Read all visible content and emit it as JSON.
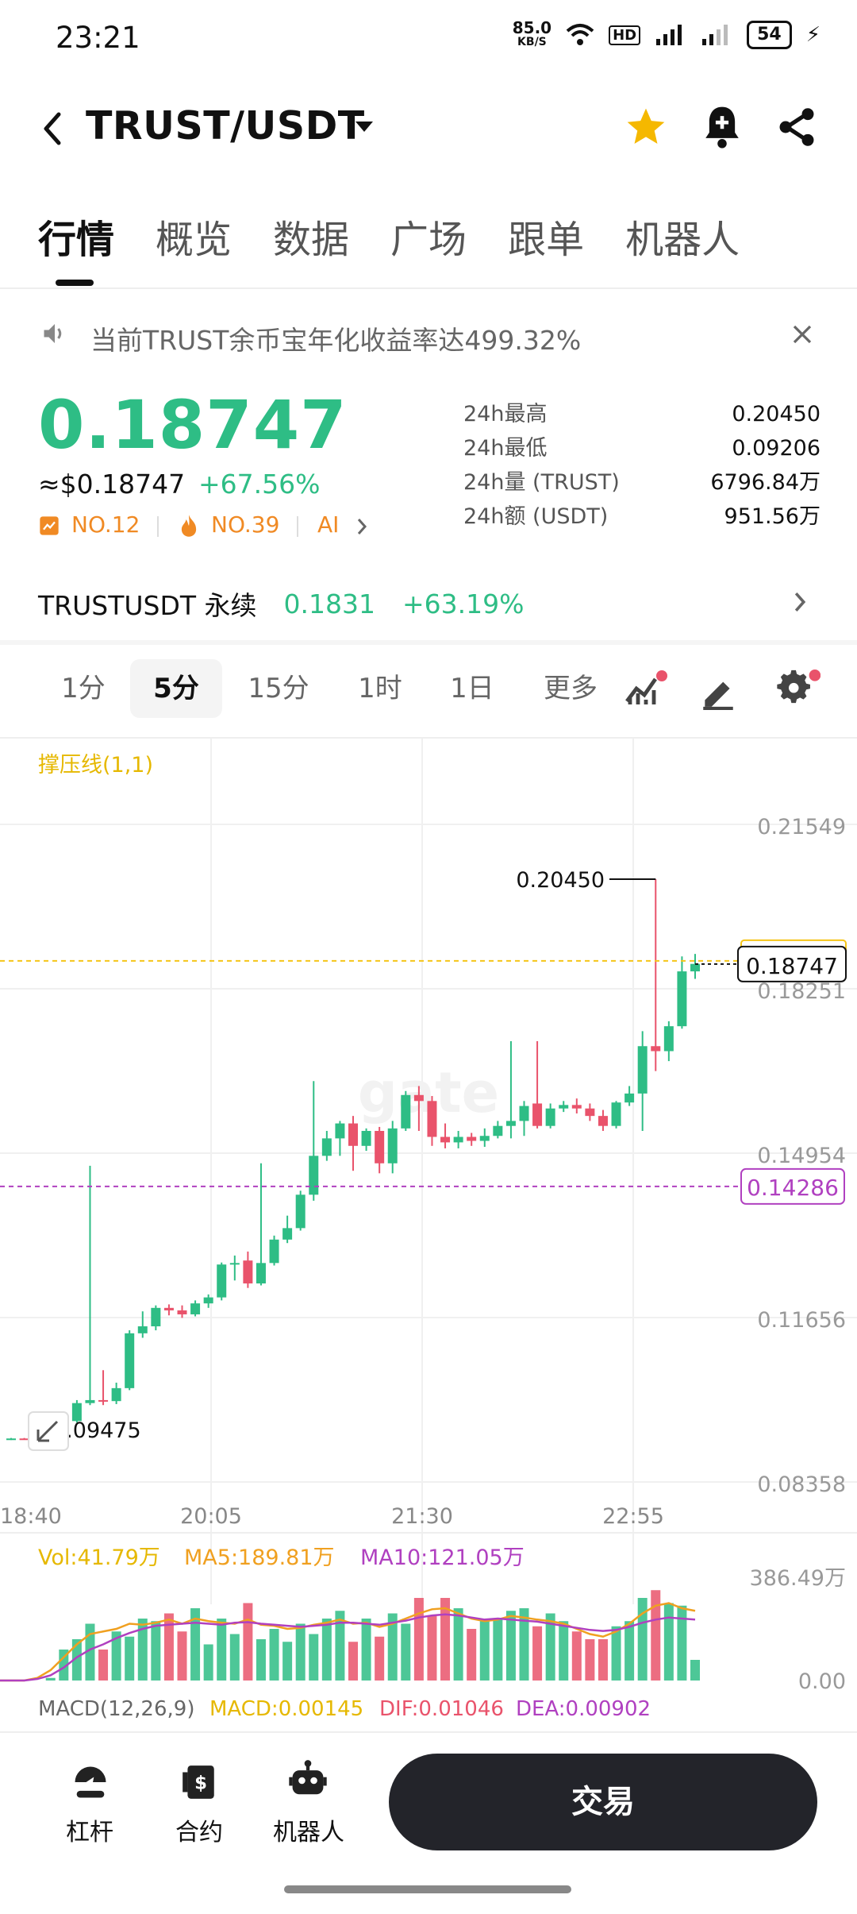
{
  "status_bar": {
    "time": "23:21",
    "net_speed_top": "85.0",
    "net_speed_unit": "KB/S",
    "battery": "54"
  },
  "header": {
    "pair": "TRUST/USDT",
    "icons": [
      "back-icon",
      "dropdown-icon",
      "star-icon",
      "bell-plus-icon",
      "share-icon"
    ]
  },
  "tabs": [
    "行情",
    "概览",
    "数据",
    "广场",
    "跟单",
    "机器人"
  ],
  "notice": {
    "text": "当前TRUST余币宝年化收益率达499.32%"
  },
  "ticker": {
    "price": "0.18747",
    "usd": "≈$0.18747",
    "change": "+67.56%",
    "rank1": "NO.12",
    "rank2": "NO.39",
    "ai": "AI",
    "stats": [
      {
        "label": "24h最高",
        "value": "0.20450"
      },
      {
        "label": "24h最低",
        "value": "0.09206"
      },
      {
        "label": "24h量 (TRUST)",
        "value": "6796.84万"
      },
      {
        "label": "24h额 (USDT)",
        "value": "951.56万"
      }
    ]
  },
  "perp": {
    "name": "TRUSTUSDT 永续",
    "price": "0.1831",
    "change": "+63.19%"
  },
  "timeframes": {
    "items": [
      "1分",
      "5分",
      "15分",
      "1时",
      "1日",
      "更多"
    ],
    "active": "5分"
  },
  "chart": {
    "indicator_label": "撑压线(1,1)",
    "y_ticks": [
      "0.21549",
      "0.18251",
      "0.14954",
      "0.11656",
      "0.08358"
    ],
    "x_ticks": [
      "18:40",
      "20:05",
      "21:30",
      "22:55"
    ],
    "high_label": "0.20450",
    "low_label": "0.09475",
    "last_price": "0.18747",
    "support_price": "0.14286",
    "vol_label": "Vol:41.79万",
    "ma5_label": "MA5:189.81万",
    "ma10_label": "MA10:121.05万",
    "vol_max": "386.49万",
    "vol_min": "0.00",
    "macd_title": "MACD(12,26,9)",
    "macd_val": "MACD:0.00145",
    "dif_val": "DIF:0.01046",
    "dea_val": "DEA:0.00902",
    "colors": {
      "up": "#2ebd85",
      "down": "#e9536b",
      "ma5": "#f0a020",
      "ma10": "#b040c0",
      "resist": "#f5c518",
      "support": "#b040c0"
    },
    "candles": [
      [
        0.0922,
        0.0924,
        0.092,
        0.0923
      ],
      [
        0.0923,
        0.0924,
        0.0921,
        0.0922
      ],
      [
        0.0922,
        0.0925,
        0.0921,
        0.0924
      ],
      [
        0.0924,
        0.0942,
        0.0922,
        0.0936
      ],
      [
        0.0936,
        0.0963,
        0.0934,
        0.0958
      ],
      [
        0.0958,
        0.1,
        0.0955,
        0.0994
      ],
      [
        0.0994,
        0.147,
        0.099,
        0.1
      ],
      [
        0.1,
        0.106,
        0.099,
        0.0998
      ],
      [
        0.0998,
        0.1035,
        0.0992,
        0.1024
      ],
      [
        0.1024,
        0.114,
        0.102,
        0.1134
      ],
      [
        0.1134,
        0.1178,
        0.1125,
        0.1148
      ],
      [
        0.1148,
        0.119,
        0.114,
        0.1185
      ],
      [
        0.1185,
        0.1192,
        0.117,
        0.118
      ],
      [
        0.118,
        0.119,
        0.1165,
        0.1172
      ],
      [
        0.1172,
        0.12,
        0.1168,
        0.1194
      ],
      [
        0.1194,
        0.1212,
        0.1185,
        0.1206
      ],
      [
        0.1206,
        0.1276,
        0.12,
        0.1272
      ],
      [
        0.1272,
        0.129,
        0.124,
        0.1275
      ],
      [
        0.128,
        0.1298,
        0.1225,
        0.1234
      ],
      [
        0.1234,
        0.1475,
        0.123,
        0.1275
      ],
      [
        0.1275,
        0.133,
        0.127,
        0.1322
      ],
      [
        0.1322,
        0.137,
        0.1315,
        0.1345
      ],
      [
        0.1345,
        0.142,
        0.134,
        0.1412
      ],
      [
        0.1412,
        0.164,
        0.14,
        0.149
      ],
      [
        0.149,
        0.154,
        0.148,
        0.1525
      ],
      [
        0.1525,
        0.156,
        0.149,
        0.1555
      ],
      [
        0.1555,
        0.157,
        0.146,
        0.151
      ],
      [
        0.151,
        0.1545,
        0.15,
        0.154
      ],
      [
        0.154,
        0.1548,
        0.1455,
        0.1475
      ],
      [
        0.1475,
        0.156,
        0.1455,
        0.1545
      ],
      [
        0.1545,
        0.162,
        0.154,
        0.1612
      ],
      [
        0.1612,
        0.163,
        0.154,
        0.16
      ],
      [
        0.16,
        0.161,
        0.151,
        0.1528
      ],
      [
        0.1528,
        0.1555,
        0.1505,
        0.1517
      ],
      [
        0.1517,
        0.154,
        0.1505,
        0.1528
      ],
      [
        0.1528,
        0.1536,
        0.151,
        0.152
      ],
      [
        0.152,
        0.1545,
        0.1508,
        0.153
      ],
      [
        0.153,
        0.156,
        0.1525,
        0.155
      ],
      [
        0.155,
        0.172,
        0.1525,
        0.156
      ],
      [
        0.156,
        0.16,
        0.153,
        0.159
      ],
      [
        0.1595,
        0.172,
        0.1545,
        0.155
      ],
      [
        0.155,
        0.1595,
        0.1545,
        0.1585
      ],
      [
        0.1585,
        0.16,
        0.1578,
        0.1592
      ],
      [
        0.1592,
        0.1605,
        0.1575,
        0.1585
      ],
      [
        0.1585,
        0.1595,
        0.156,
        0.157
      ],
      [
        0.157,
        0.1582,
        0.154,
        0.155
      ],
      [
        0.155,
        0.16,
        0.1545,
        0.1597
      ],
      [
        0.1597,
        0.163,
        0.159,
        0.1615
      ],
      [
        0.1615,
        0.174,
        0.154,
        0.171
      ],
      [
        0.171,
        0.2045,
        0.166,
        0.17
      ],
      [
        0.17,
        0.176,
        0.168,
        0.175
      ],
      [
        0.175,
        0.189,
        0.1745,
        0.186
      ],
      [
        0.186,
        0.1895,
        0.1845,
        0.1875
      ]
    ],
    "volumes": [
      0,
      0,
      0,
      5,
      60,
      80,
      110,
      60,
      95,
      85,
      120,
      115,
      130,
      95,
      140,
      70,
      120,
      90,
      150,
      80,
      100,
      75,
      110,
      90,
      120,
      135,
      75,
      120,
      85,
      130,
      110,
      160,
      125,
      160,
      140,
      100,
      115,
      120,
      135,
      140,
      105,
      130,
      115,
      95,
      80,
      80,
      105,
      115,
      160,
      175,
      150,
      145,
      40
    ],
    "ma5": [
      0,
      0,
      5,
      20,
      45,
      70,
      90,
      95,
      100,
      110,
      108,
      112,
      118,
      110,
      120,
      115,
      112,
      110,
      118,
      108,
      106,
      100,
      102,
      108,
      112,
      118,
      110,
      112,
      104,
      110,
      120,
      130,
      138,
      140,
      130,
      120,
      115,
      118,
      125,
      122,
      118,
      115,
      110,
      100,
      90,
      85,
      95,
      110,
      130,
      145,
      150,
      140,
      135
    ],
    "ma10": [
      0,
      0,
      3,
      10,
      25,
      45,
      60,
      70,
      82,
      92,
      100,
      106,
      108,
      110,
      112,
      110,
      108,
      112,
      113,
      110,
      108,
      106,
      104,
      106,
      108,
      112,
      112,
      110,
      108,
      112,
      116,
      122,
      126,
      128,
      126,
      122,
      118,
      120,
      118,
      116,
      114,
      110,
      106,
      102,
      98,
      96,
      98,
      104,
      112,
      118,
      122,
      120,
      118
    ]
  },
  "bottom_nav": {
    "items": [
      "杠杆",
      "合约",
      "机器人"
    ],
    "trade": "交易"
  }
}
